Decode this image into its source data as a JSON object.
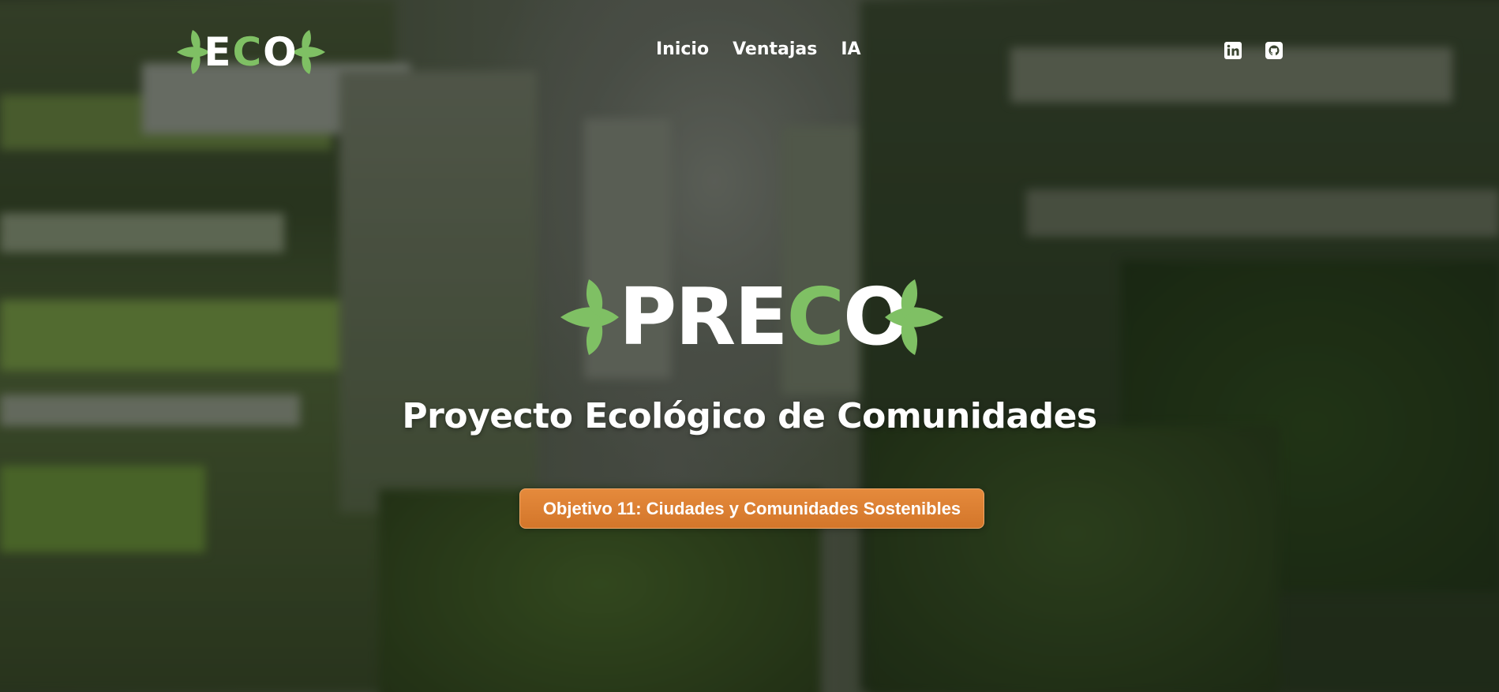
{
  "header": {
    "logo": {
      "prefix": "E",
      "highlight": "C",
      "suffix": "O"
    },
    "nav": [
      {
        "label": "Inicio"
      },
      {
        "label": "Ventajas"
      },
      {
        "label": "IA"
      }
    ],
    "socials": [
      {
        "icon": "linkedin-icon"
      },
      {
        "icon": "github-icon"
      }
    ]
  },
  "hero": {
    "logo": {
      "prefix": "PRE",
      "highlight": "C",
      "suffix": "O"
    },
    "title": "Proyecto Ecológico de Comunidades",
    "cta_label": "Objetivo 11: Ciudades y Comunidades Sostenibles"
  },
  "colors": {
    "accent_green": "#7fc064",
    "cta_orange": "#de8132",
    "text": "#ffffff"
  }
}
